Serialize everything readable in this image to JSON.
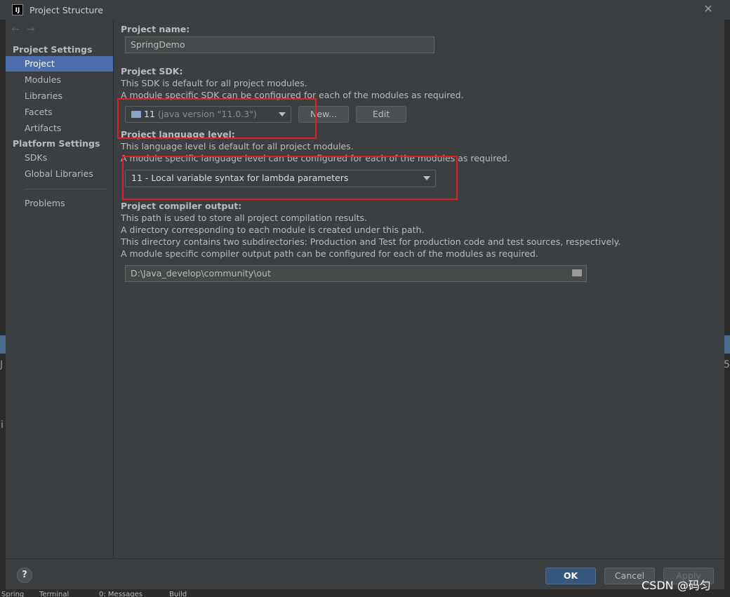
{
  "window": {
    "title": "Project Structure",
    "app_icon": "IJ"
  },
  "sidebar": {
    "project_settings_heading": "Project Settings",
    "project_settings_items": [
      "Project",
      "Modules",
      "Libraries",
      "Facets",
      "Artifacts"
    ],
    "platform_settings_heading": "Platform Settings",
    "platform_settings_items": [
      "SDKs",
      "Global Libraries"
    ],
    "other_items": [
      "Problems"
    ],
    "selected_item": "Project",
    "selected_color": "#4b6eaf"
  },
  "content": {
    "project_name_label": "Project name:",
    "project_name_value": "SpringDemo",
    "sdk_label": "Project SDK:",
    "sdk_desc1": "This SDK is default for all project modules.",
    "sdk_desc2": "A module specific SDK can be configured for each of the modules as required.",
    "sdk_selected_version": "11",
    "sdk_selected_detail": "(java version \"11.0.3\")",
    "new_button": "New...",
    "edit_button": "Edit",
    "language_level_label": "Project language level:",
    "language_level_desc1": "This language level is default for all project modules.",
    "language_level_desc2": "A module specific language level can be configured for each of the modules as required.",
    "language_level_value": "11 - Local variable syntax for lambda parameters",
    "compiler_output_label": "Project compiler output:",
    "compiler_desc1": "This path is used to store all project compilation results.",
    "compiler_desc2": "A directory corresponding to each module is created under this path.",
    "compiler_desc3": "This directory contains two subdirectories: Production and Test for production code and test sources, respectively.",
    "compiler_desc4": "A module specific compiler output path can be configured for each of the modules as required.",
    "compiler_output_path": "D:\\Java_develop\\community\\out"
  },
  "footer": {
    "help_label": "?",
    "ok_button": "OK",
    "cancel_button": "Cancel",
    "apply_button": "Apply"
  },
  "statusbar": {
    "items": [
      "Spring",
      "Terminal",
      "0: Messages",
      "Build"
    ]
  },
  "background_glyphs": {
    "left1": "J",
    "left2": "i",
    "right1": "5"
  },
  "watermark": "CSDN @码匀",
  "colors": {
    "accent": "#4b6eaf",
    "highlight_box": "#e02020",
    "primary_button": "#365880"
  }
}
